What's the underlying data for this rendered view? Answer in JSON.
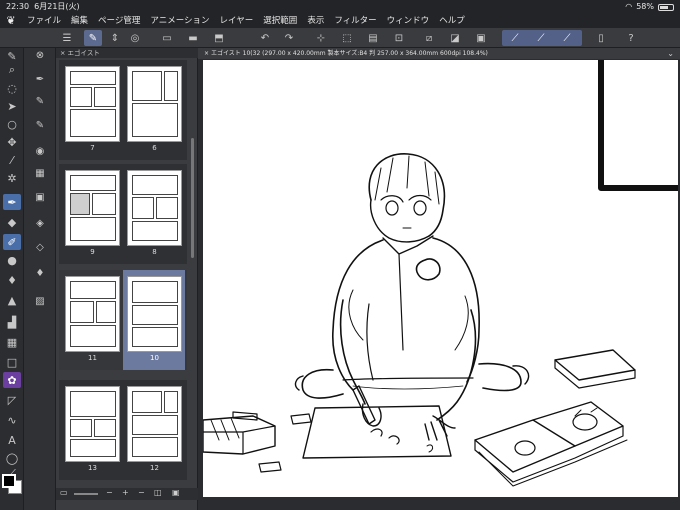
{
  "status": {
    "time": "22:30",
    "date": "6月21日(火)",
    "battery": "58%",
    "battery_level": 0.58
  },
  "menu": {
    "items": [
      "ファイル",
      "編集",
      "ページ管理",
      "アニメーション",
      "レイヤー",
      "選択範囲",
      "表示",
      "フィルター",
      "ウィンドウ",
      "ヘルプ"
    ]
  },
  "pages_panel": {
    "tab_label": "エゴイスト",
    "spreads": [
      {
        "left": "7",
        "right": "6"
      },
      {
        "left": "9",
        "right": "8"
      },
      {
        "left": "11",
        "right": "10"
      },
      {
        "left": "13",
        "right": "12"
      }
    ]
  },
  "document": {
    "tab_label": "エゴイスト 10(32 (297.00 x 420.00mm 製本サイズ:B4 判 257.00 x 364.00mm 600dpi 108.4%)"
  },
  "colors": {
    "accent": "#536189",
    "selected": "#6c7aa0"
  }
}
